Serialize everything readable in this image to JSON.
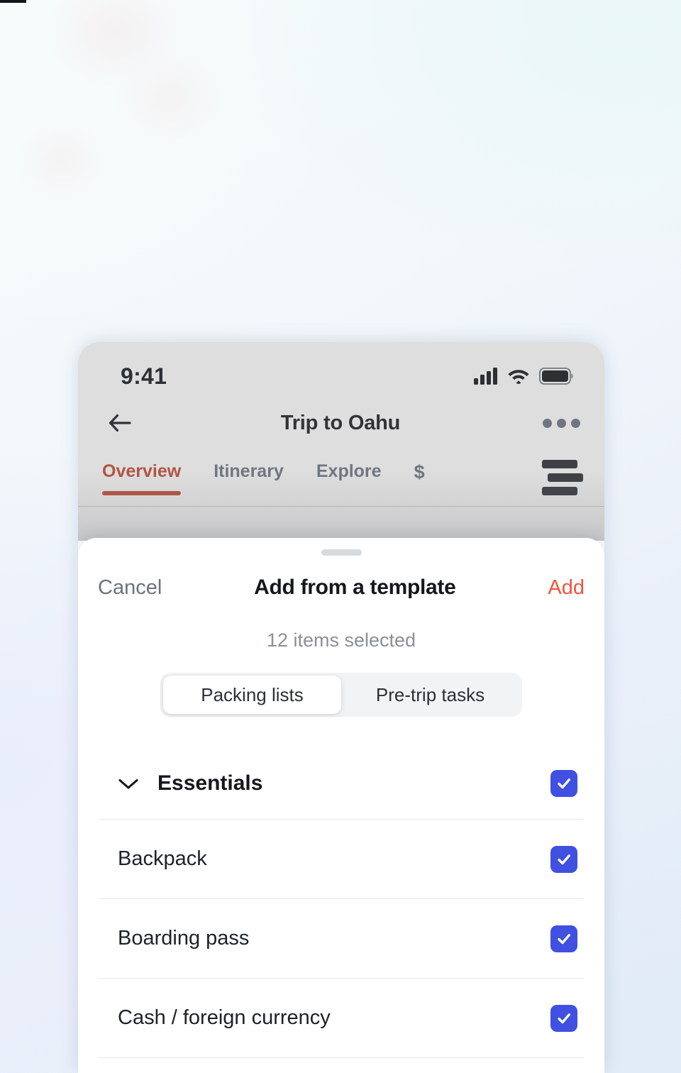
{
  "statusbar": {
    "time": "9:41",
    "icons": [
      "cellular-signal-icon",
      "wifi-icon",
      "battery-icon"
    ]
  },
  "navbar": {
    "back_icon": "back-arrow-icon",
    "title": "Trip to Oahu",
    "more_icon": "more-horizontal-icon"
  },
  "tabs": {
    "items": [
      {
        "label": "Overview",
        "active": true
      },
      {
        "label": "Itinerary",
        "active": false
      },
      {
        "label": "Explore",
        "active": false
      },
      {
        "label": "$",
        "active": false
      }
    ],
    "menu_icon": "hamburger-menu-icon",
    "active_color": "#c4452f"
  },
  "sheet": {
    "grabber": "sheet-grabber",
    "cancel_label": "Cancel",
    "title": "Add from a template",
    "add_label": "Add",
    "add_color": "#f4533c",
    "selected_count": "12 items selected",
    "segmented": {
      "options": [
        {
          "label": "Packing lists",
          "active": true
        },
        {
          "label": "Pre-trip tasks",
          "active": false
        }
      ]
    },
    "checkbox_color": "#4050e0",
    "list": [
      {
        "label": "Essentials",
        "type": "group",
        "checked": true,
        "chevron": "chevron-down-icon"
      },
      {
        "label": "Backpack",
        "type": "item",
        "checked": true
      },
      {
        "label": "Boarding pass",
        "type": "item",
        "checked": true
      },
      {
        "label": "Cash / foreign currency",
        "type": "item",
        "checked": true
      }
    ]
  }
}
